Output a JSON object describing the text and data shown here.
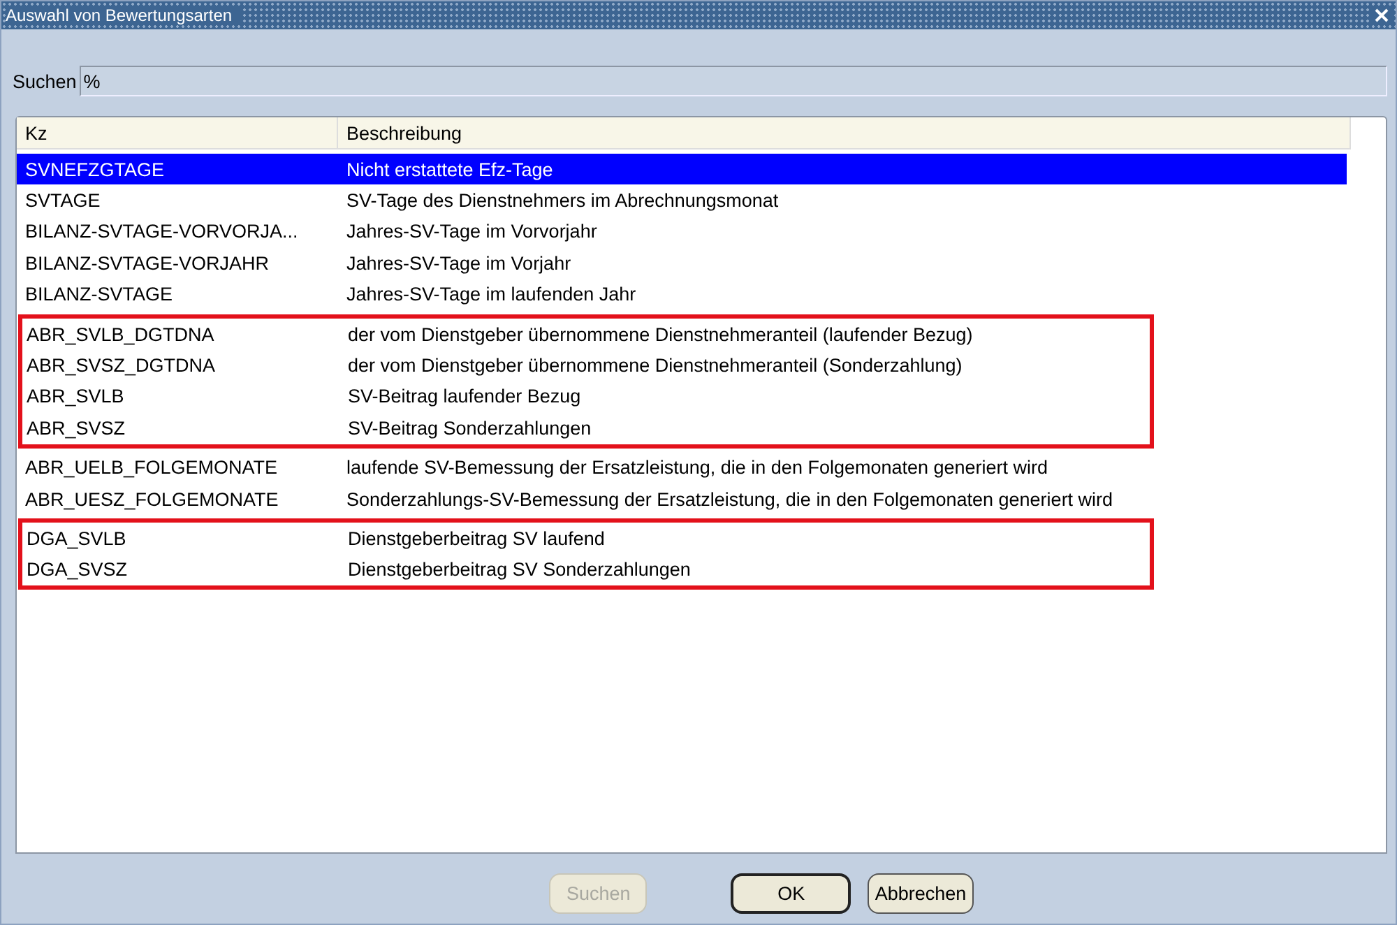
{
  "window": {
    "title": "Auswahl von Bewertungsarten"
  },
  "search": {
    "label": "Suchen",
    "value": "%"
  },
  "table": {
    "columns": [
      "Kz",
      "Beschreibung"
    ],
    "groups": [
      {
        "highlighted": false,
        "rows": [
          {
            "kz": "SVNEFZGTAGE",
            "beschreibung": "Nicht erstattete Efz-Tage",
            "selected": true
          },
          {
            "kz": "SVTAGE",
            "beschreibung": "SV-Tage des Dienstnehmers im Abrechnungsmonat",
            "selected": false
          },
          {
            "kz": "BILANZ-SVTAGE-VORVORJA...",
            "beschreibung": "Jahres-SV-Tage im Vorvorjahr",
            "selected": false
          },
          {
            "kz": "BILANZ-SVTAGE-VORJAHR",
            "beschreibung": "Jahres-SV-Tage im Vorjahr",
            "selected": false
          },
          {
            "kz": "BILANZ-SVTAGE",
            "beschreibung": "Jahres-SV-Tage im laufenden Jahr",
            "selected": false
          }
        ]
      },
      {
        "highlighted": true,
        "rows": [
          {
            "kz": "ABR_SVLB_DGTDNA",
            "beschreibung": "der vom Dienstgeber übernommene Dienstnehmeranteil (laufender Bezug)",
            "selected": false
          },
          {
            "kz": "ABR_SVSZ_DGTDNA",
            "beschreibung": "der vom Dienstgeber übernommene Dienstnehmeranteil (Sonderzahlung)",
            "selected": false
          },
          {
            "kz": "ABR_SVLB",
            "beschreibung": "SV-Beitrag laufender Bezug",
            "selected": false
          },
          {
            "kz": "ABR_SVSZ",
            "beschreibung": "SV-Beitrag Sonderzahlungen",
            "selected": false
          }
        ]
      },
      {
        "highlighted": false,
        "rows": [
          {
            "kz": "ABR_UELB_FOLGEMONATE",
            "beschreibung": "laufende SV-Bemessung der Ersatzleistung, die in den Folgemonaten generiert wird",
            "selected": false
          },
          {
            "kz": "ABR_UESZ_FOLGEMONATE",
            "beschreibung": "Sonderzahlungs-SV-Bemessung der Ersatzleistung, die in den Folgemonaten generiert wird",
            "selected": false
          }
        ]
      },
      {
        "highlighted": true,
        "rows": [
          {
            "kz": "DGA_SVLB",
            "beschreibung": "Dienstgeberbeitrag SV laufend",
            "selected": false
          },
          {
            "kz": "DGA_SVSZ",
            "beschreibung": "Dienstgeberbeitrag SV Sonderzahlungen",
            "selected": false
          }
        ]
      }
    ]
  },
  "buttons": [
    {
      "label": "Suchen",
      "disabled": true,
      "default": false
    },
    {
      "label": "OK",
      "disabled": false,
      "default": true
    },
    {
      "label": "Abbrechen",
      "disabled": false,
      "default": false
    }
  ]
}
